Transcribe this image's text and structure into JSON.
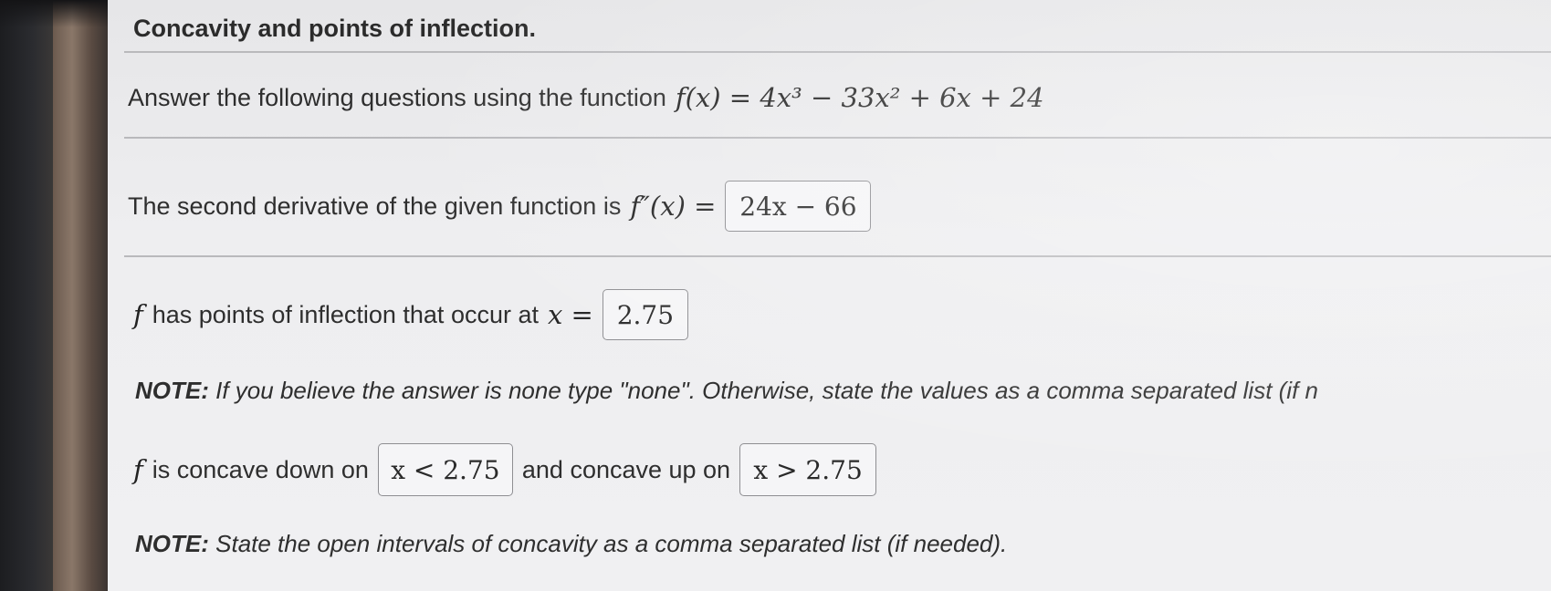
{
  "title": "Concavity and points of inflection.",
  "question": {
    "prefix": "Answer the following questions using the function",
    "function_label": "f(x) = 4x³ − 33x² + 6x + 24"
  },
  "second_derivative": {
    "prefix": "The second derivative of the given function is",
    "label": "f″(x) =",
    "value": "24x − 66"
  },
  "inflection": {
    "f_symbol": "f",
    "text": "has points of inflection that occur at",
    "label": "x =",
    "value": "2.75"
  },
  "note1": {
    "bold": "NOTE:",
    "text": "If you believe the answer is none type \"none\". Otherwise, state the values as a comma separated list (if n"
  },
  "concavity": {
    "f_symbol": "f",
    "down_text": "is concave down on",
    "down_value": "x < 2.75",
    "up_text": "and concave up on",
    "up_value": "x > 2.75"
  },
  "note2": {
    "bold": "NOTE:",
    "text": "State the open intervals of concavity as a comma separated list (if needed)."
  }
}
